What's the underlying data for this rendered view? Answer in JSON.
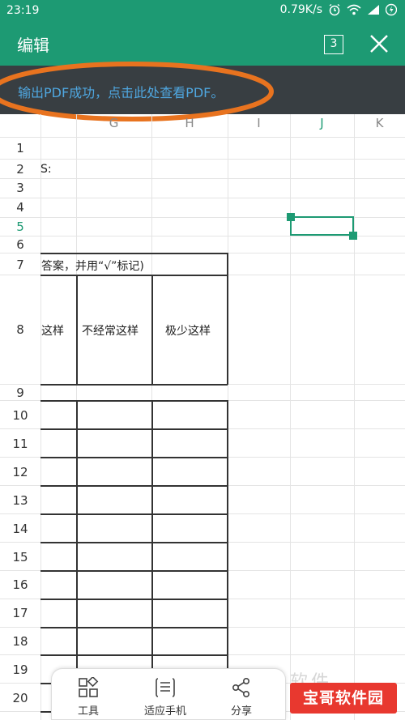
{
  "status_bar": {
    "time": "23:19",
    "net_speed": "0.79K/s",
    "icons": [
      "alarm-icon",
      "wifi-icon",
      "signal-icon",
      "battery-charging-icon"
    ]
  },
  "app_bar": {
    "title": "编辑",
    "sheet_count": "3",
    "close_icon": "close-icon"
  },
  "banner": {
    "message": "输出PDF成功，点击此处查看PDF。"
  },
  "sheet": {
    "col_headers": [
      "G",
      "H",
      "I",
      "J",
      "K"
    ],
    "active_col": "J",
    "rows": [
      "1",
      "2",
      "3",
      "4",
      "5",
      "6",
      "7",
      "8",
      "9",
      "10",
      "11",
      "12",
      "13",
      "14",
      "15",
      "16",
      "17",
      "18",
      "19",
      "20"
    ],
    "active_row": "5",
    "cells": {
      "row2": "S:",
      "row7": "答案，并用“√”标记)",
      "row8_col_a": "这样",
      "row8_col_b": "不经常这样",
      "row8_col_c": "极少这样"
    }
  },
  "toolbar": {
    "tools": [
      {
        "label": "工具",
        "icon": "grid-tools-icon"
      },
      {
        "label": "适应手机",
        "icon": "fit-phone-icon"
      },
      {
        "label": "分享",
        "icon": "share-icon"
      }
    ]
  },
  "watermark": {
    "text": "宝哥软件园",
    "faint_text": "软件"
  },
  "colors": {
    "accent": "#1d9a73",
    "banner_bg": "#383e42",
    "banner_text": "#4fa7e0",
    "highlight_ring": "#e8731f",
    "watermark_bg": "#e8382f"
  }
}
